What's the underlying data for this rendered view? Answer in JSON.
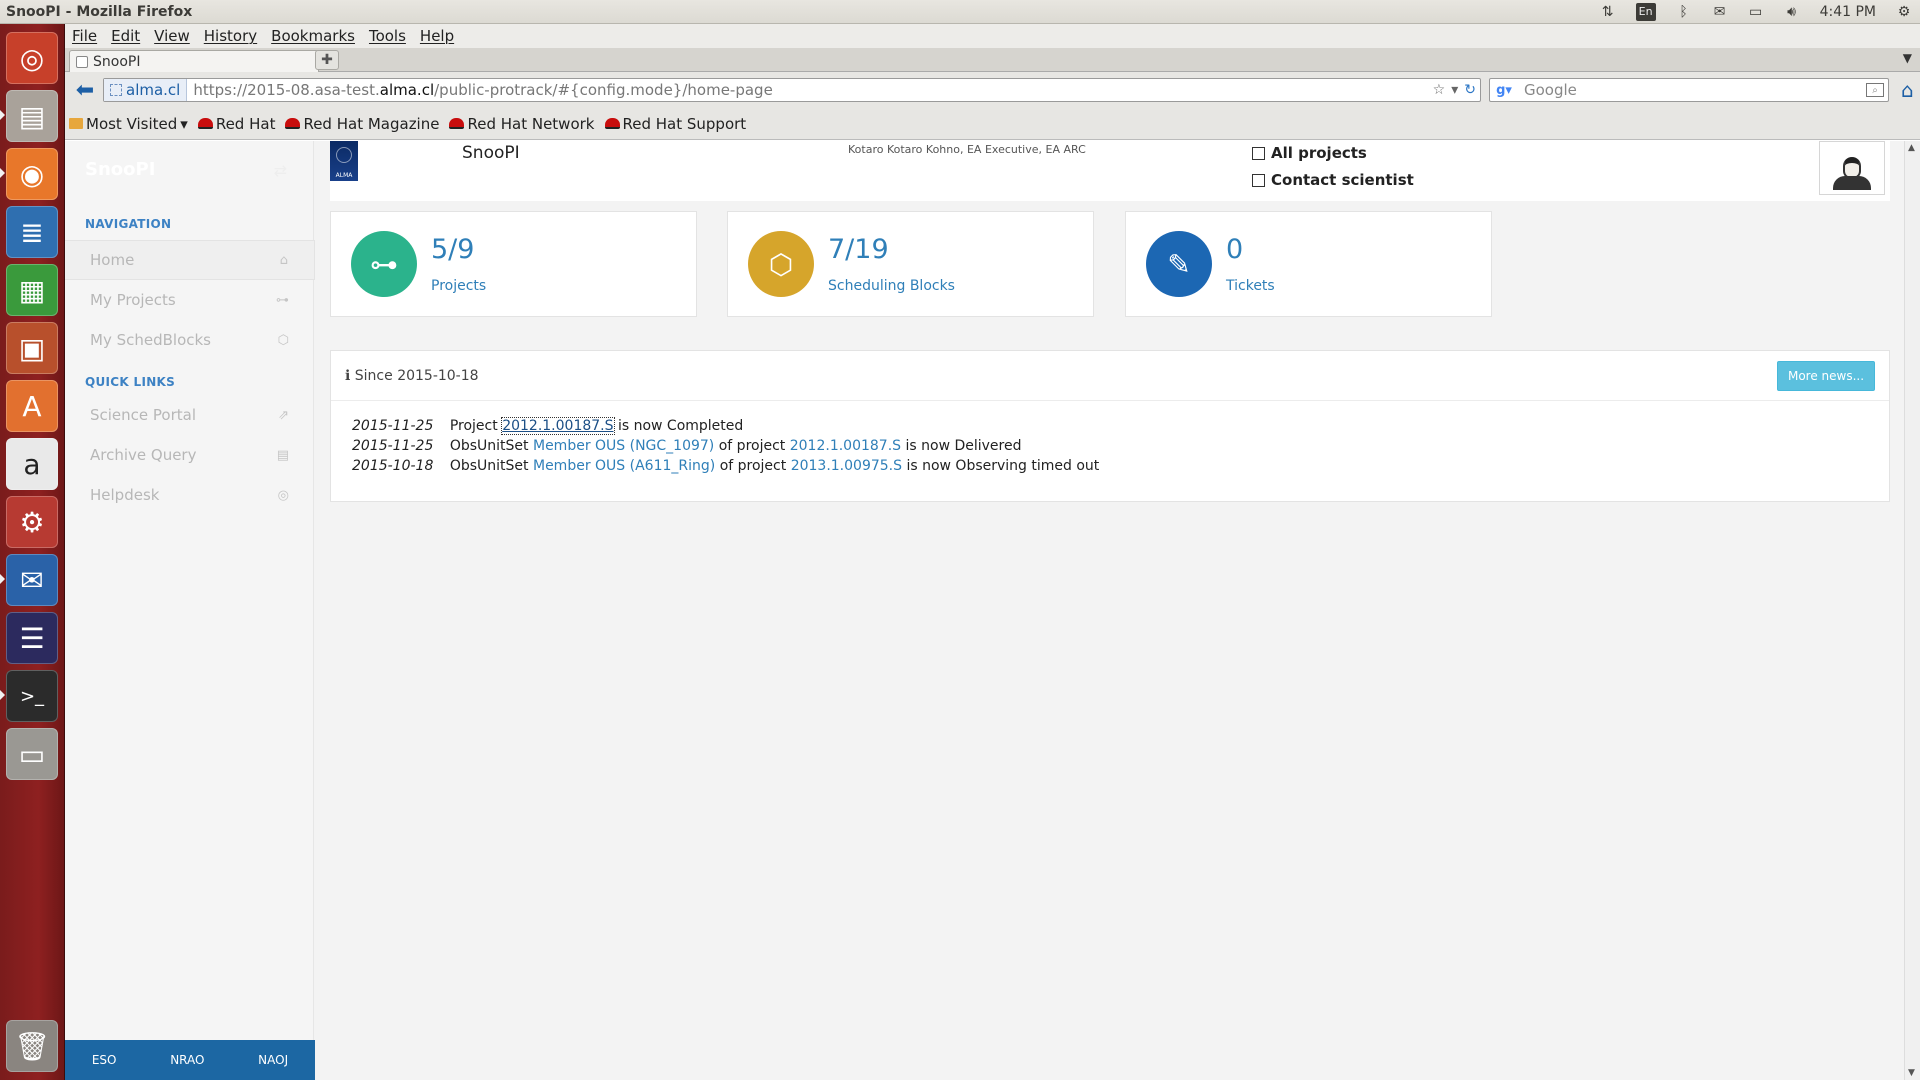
{
  "panel": {
    "window_title": "SnooPI - Mozilla Firefox",
    "keyboard_layout": "En",
    "clock": "4:41 PM"
  },
  "launcher": {
    "icons": [
      "ubuntu-dash-icon",
      "files-icon",
      "firefox-icon",
      "writer-icon",
      "calc-icon",
      "impress-icon",
      "software-center-icon",
      "amazon-icon",
      "system-settings-icon",
      "thunderbird-icon",
      "eclipse-icon",
      "terminal-icon",
      "disk-icon",
      "trash-icon"
    ]
  },
  "browser": {
    "menu": [
      "File",
      "Edit",
      "View",
      "History",
      "Bookmarks",
      "Tools",
      "Help"
    ],
    "tab_title": "SnooPI",
    "url_identity": "alma.cl",
    "url_prefix": "https://2015-08.asa-test.",
    "url_domain": "alma.cl",
    "url_suffix": "/public-protrack/#{config.mode}/home-page",
    "search_placeholder": "Google",
    "bookmarks": [
      "Most Visited",
      "Red Hat",
      "Red Hat Magazine",
      "Red Hat Network",
      "Red Hat Support"
    ]
  },
  "sidebar": {
    "brand": "SnooPI",
    "nav_heading": "NAVIGATION",
    "nav_items": [
      {
        "label": "Home",
        "icon": "home-icon"
      },
      {
        "label": "My Projects",
        "icon": "sitemap-icon"
      },
      {
        "label": "My SchedBlocks",
        "icon": "cube-icon"
      }
    ],
    "links_heading": "QUICK LINKS",
    "link_items": [
      {
        "label": "Science Portal",
        "icon": "external-link-icon"
      },
      {
        "label": "Archive Query",
        "icon": "archive-icon"
      },
      {
        "label": "Helpdesk",
        "icon": "life-ring-icon"
      }
    ],
    "footer": [
      "ESO",
      "NRAO",
      "NAOJ"
    ]
  },
  "header": {
    "logo_text": "ALMA",
    "app_name": "SnooPI",
    "user": "Kotaro Kotaro Kohno, EA Executive, EA ARC",
    "filters": [
      {
        "label": "All projects",
        "checked": false
      },
      {
        "label": "Contact scientist",
        "checked": false
      }
    ]
  },
  "stats": [
    {
      "value": "5/9",
      "label": "Projects",
      "icon": "sitemap-icon",
      "color": "#2bb38c"
    },
    {
      "value": "7/19",
      "label": "Scheduling Blocks",
      "icon": "cube-icon",
      "color": "#d6a52b"
    },
    {
      "value": "0",
      "label": "Tickets",
      "icon": "ticket-icon",
      "color": "#1c67b3"
    }
  ],
  "news": {
    "since": "Since 2015-10-18",
    "more_button": "More news...",
    "items": [
      {
        "date": "2015-11-25",
        "t1": "Project",
        "l1": "2012.1.00187.S",
        "t2": "is now Completed",
        "l2": "",
        "t3": "",
        "l3": "",
        "t4": ""
      },
      {
        "date": "2015-11-25",
        "t1": "ObsUnitSet",
        "l1": "Member OUS (NGC_1097)",
        "t2": "of project",
        "l2": "2012.1.00187.S",
        "t3": "is now Delivered",
        "l3": "",
        "t4": ""
      },
      {
        "date": "2015-10-18",
        "t1": "ObsUnitSet",
        "l1": "Member OUS (A611_Ring)",
        "t2": "of project",
        "l2": "2013.1.00975.S",
        "t3": "is now Observing timed out",
        "l3": "",
        "t4": ""
      }
    ]
  }
}
